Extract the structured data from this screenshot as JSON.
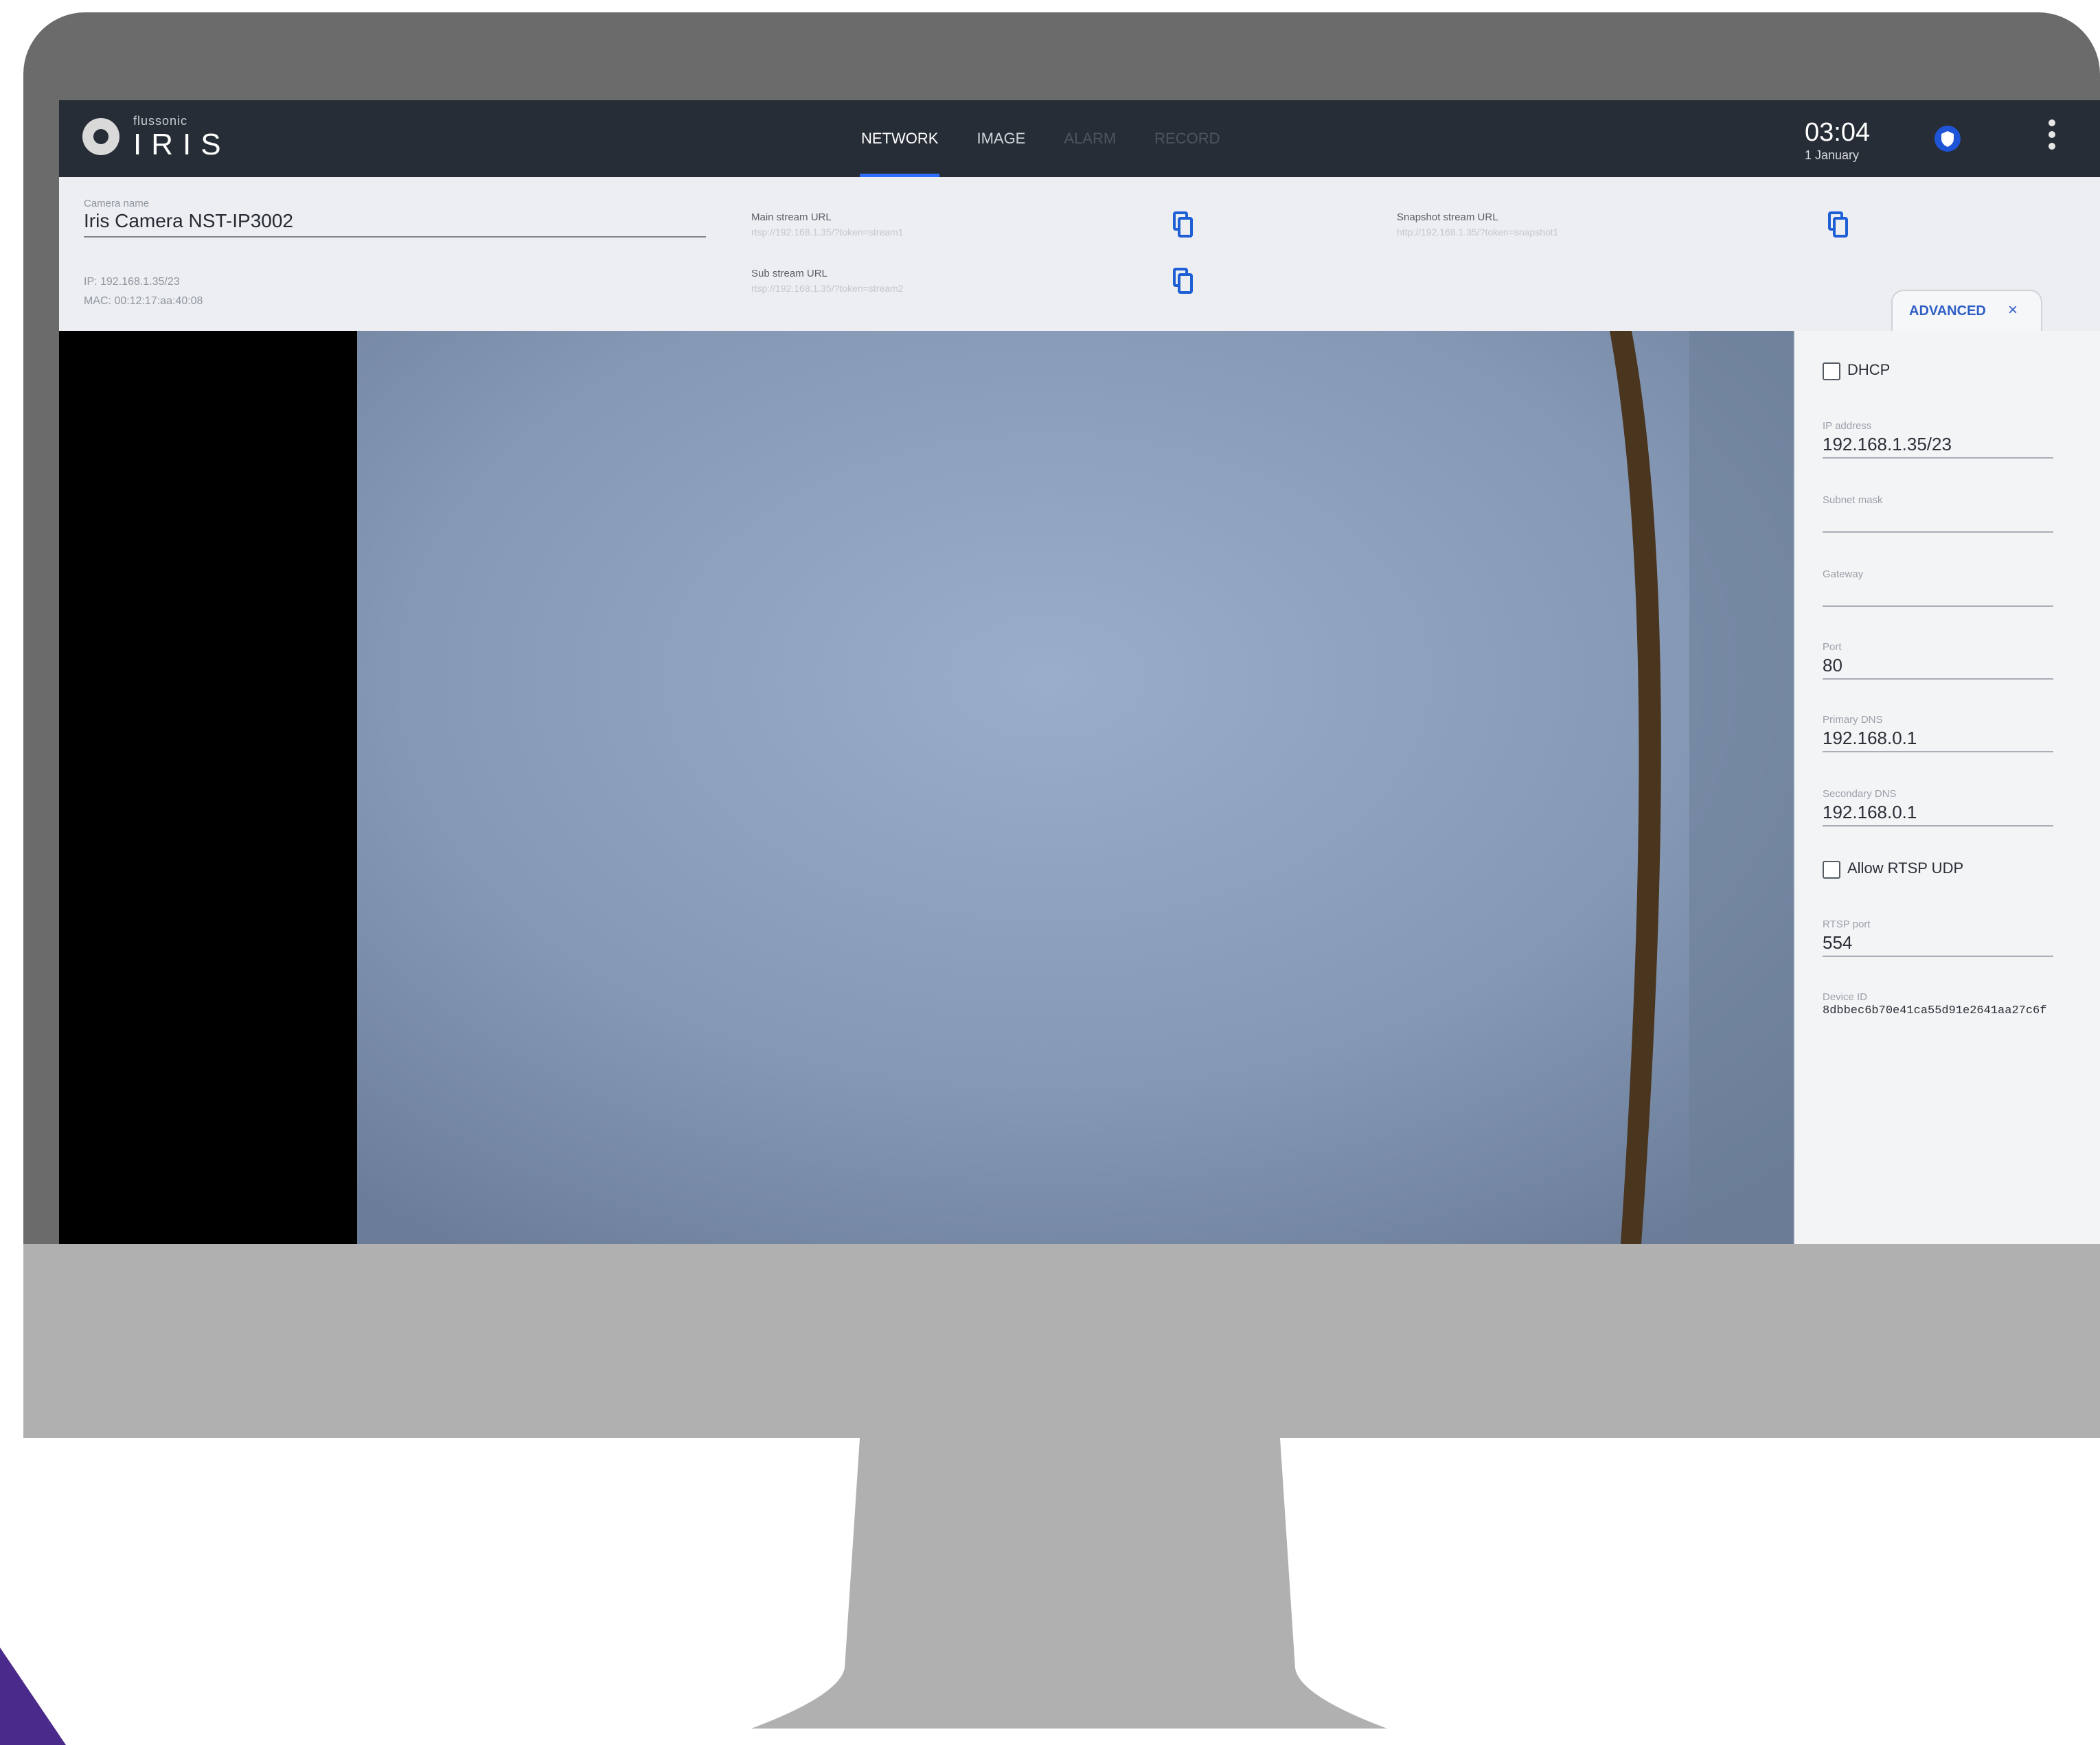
{
  "app": {
    "brand_small": "flussonic",
    "brand_big": "IRIS"
  },
  "nav": {
    "tabs": [
      {
        "label": "NETWORK"
      },
      {
        "label": "IMAGE"
      },
      {
        "label": "ALARM"
      },
      {
        "label": "RECORD"
      }
    ]
  },
  "clock": {
    "time": "03:04",
    "date": "1 January"
  },
  "camera": {
    "name_label": "Camera name",
    "name_value": "Iris Camera NST-IP3002",
    "ip": "IP: 192.168.1.35/23",
    "mac": "MAC: 00:12:17:aa:40:08"
  },
  "streams": {
    "main_label": "Main stream URL",
    "main_url": "rtsp://192.168.1.35/?token=stream1",
    "sub_label": "Sub stream URL",
    "sub_url": "rtsp://192.168.1.35/?token=stream2",
    "snapshot_label": "Snapshot stream URL",
    "snapshot_url": "http://192.168.1.35/?token=snapshot1"
  },
  "advanced": {
    "tab_label": "ADVANCED",
    "close_glyph": "×"
  },
  "network_form": {
    "dhcp_label": "DHCP",
    "ip_label": "IP address",
    "ip_value": "192.168.1.35/23",
    "subnet_label": "Subnet mask",
    "subnet_value": "",
    "gateway_label": "Gateway",
    "gateway_value": "",
    "port_label": "Port",
    "port_value": "80",
    "dns1_label": "Primary DNS",
    "dns1_value": "192.168.0.1",
    "dns2_label": "Secondary DNS",
    "dns2_value": "192.168.0.1",
    "rtsp_udp_label": "Allow RTSP UDP",
    "rtsp_port_label": "RTSP port",
    "rtsp_port_value": "554",
    "device_id_label": "Device ID",
    "device_id_value": "8dbbec6b70e41ca55d91e2641aa27c6f"
  },
  "colors": {
    "accent": "#2f6dff",
    "topbar": "#272d36",
    "bezel": "#6b6b6b",
    "stand": "#b0b0b0"
  }
}
